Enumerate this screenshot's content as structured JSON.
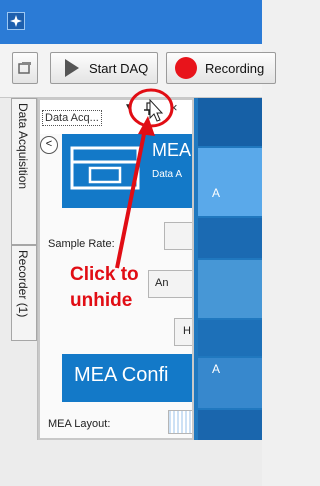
{
  "toolbar": {
    "start_daq_label": "Start DAQ",
    "recording_label": "Recording"
  },
  "side_tabs": {
    "data_acquisition": "Data Acquisition",
    "recorder": "Recorder (1)"
  },
  "panel": {
    "title": "Data Acq...",
    "banner_title": "MEA",
    "banner_subtitle": "Data A",
    "sample_rate_label": "Sample Rate:",
    "button_an": "An",
    "button_h": "H",
    "config_title": "MEA Confi",
    "layout_label": "MEA Layout:"
  },
  "grid": {
    "cell_a1": "A",
    "cell_a2": "A"
  },
  "annotation": {
    "line1": "Click to",
    "line2": "unhide"
  },
  "colors": {
    "title_bar": "#2b7bd6",
    "accent_blue": "#1379c8",
    "record_red": "#e8141b",
    "annotation_red": "#e10d14"
  }
}
